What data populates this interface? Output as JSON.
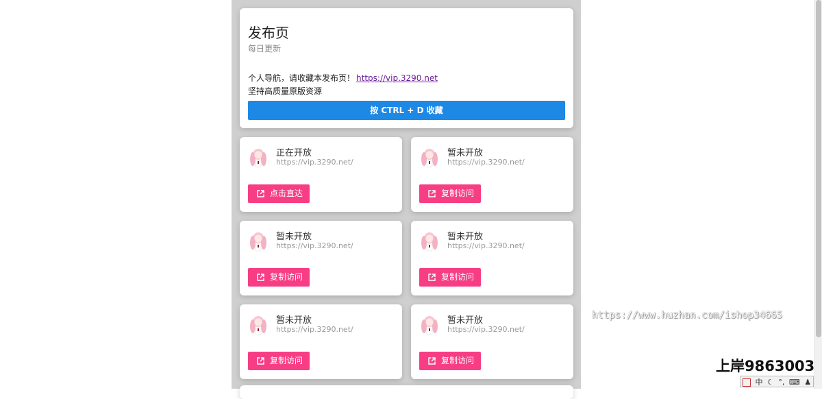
{
  "header": {
    "title": "发布页",
    "subtitle": "每日更新",
    "intro_text": "个人导航，请收藏本发布页！",
    "intro_link": "https://vip.3290.net",
    "tagline": "坚持高质量原版资源",
    "bookmark_button": "按 CTRL + D 收藏"
  },
  "items": [
    {
      "title": "正在开放",
      "url": "https://vip.3290.net/",
      "button": "点击直达"
    },
    {
      "title": "暂未开放",
      "url": "https://vip.3290.net/",
      "button": "复制访问"
    },
    {
      "title": "暂未开放",
      "url": "https://vip.3290.net/",
      "button": "复制访问"
    },
    {
      "title": "暂未开放",
      "url": "https://vip.3290.net/",
      "button": "复制访问"
    },
    {
      "title": "暂未开放",
      "url": "https://vip.3290.net/",
      "button": "复制访问"
    },
    {
      "title": "暂未开放",
      "url": "https://vip.3290.net/",
      "button": "复制访问"
    }
  ],
  "overlay": {
    "watermark": "https://www.huzhan.com/ishop34665",
    "contact": "上岸9863003",
    "ime_lang": "中"
  },
  "colors": {
    "primary_button": "#1e88e5",
    "accent_button": "#f73e85",
    "link": "#6a1b9a"
  },
  "icons": [
    "external-link-icon",
    "avatar-anime-girl-icon"
  ]
}
